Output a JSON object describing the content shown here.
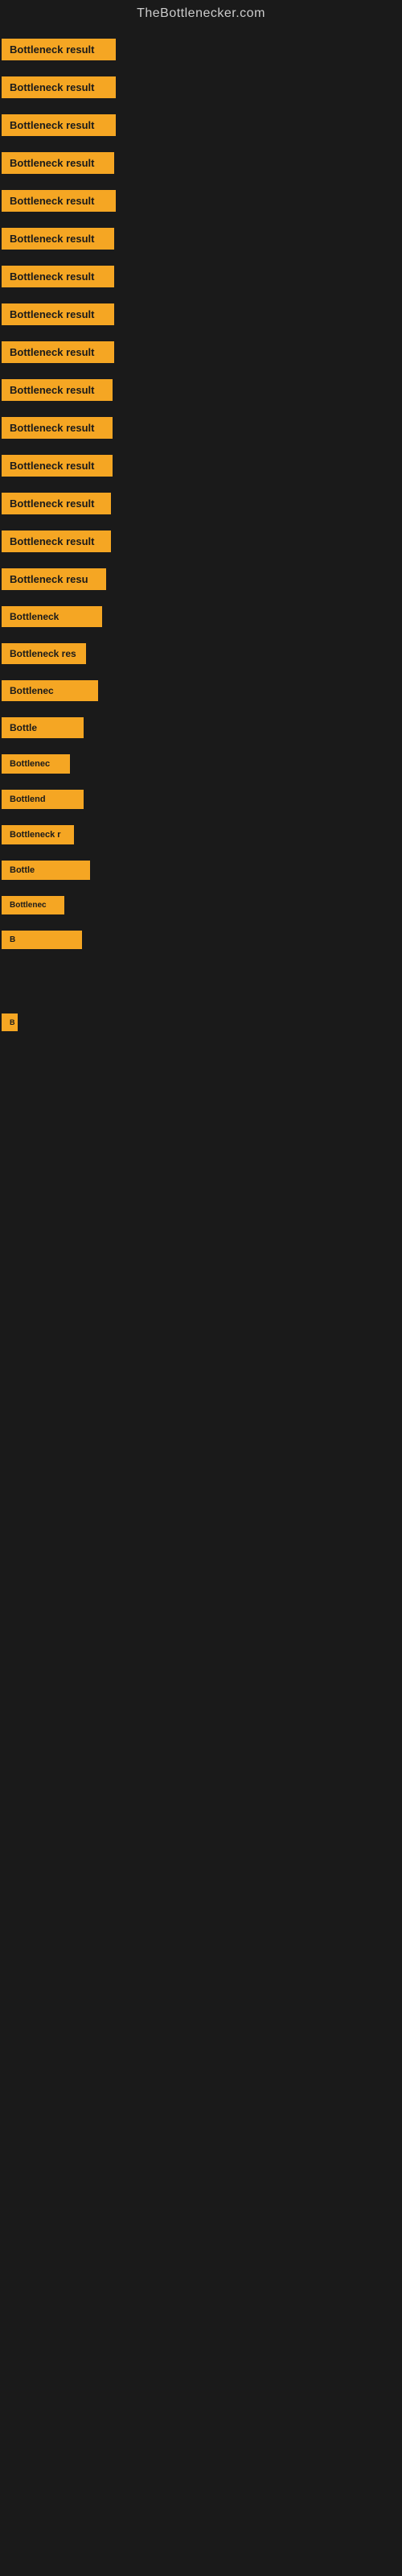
{
  "site": {
    "title": "TheBottlenecker.com"
  },
  "items": [
    {
      "id": 1,
      "label": "Bottleneck result"
    },
    {
      "id": 2,
      "label": "Bottleneck result"
    },
    {
      "id": 3,
      "label": "Bottleneck result"
    },
    {
      "id": 4,
      "label": "Bottleneck result"
    },
    {
      "id": 5,
      "label": "Bottleneck result"
    },
    {
      "id": 6,
      "label": "Bottleneck result"
    },
    {
      "id": 7,
      "label": "Bottleneck result"
    },
    {
      "id": 8,
      "label": "Bottleneck result"
    },
    {
      "id": 9,
      "label": "Bottleneck result"
    },
    {
      "id": 10,
      "label": "Bottleneck result"
    },
    {
      "id": 11,
      "label": "Bottleneck result"
    },
    {
      "id": 12,
      "label": "Bottleneck result"
    },
    {
      "id": 13,
      "label": "Bottleneck result"
    },
    {
      "id": 14,
      "label": "Bottleneck result"
    },
    {
      "id": 15,
      "label": "Bottleneck resu"
    },
    {
      "id": 16,
      "label": "Bottleneck"
    },
    {
      "id": 17,
      "label": "Bottleneck res"
    },
    {
      "id": 18,
      "label": "Bottlenec"
    },
    {
      "id": 19,
      "label": "Bottle"
    },
    {
      "id": 20,
      "label": "Bottlenec"
    },
    {
      "id": 21,
      "label": "Bottlend"
    },
    {
      "id": 22,
      "label": "Bottleneck r"
    },
    {
      "id": 23,
      "label": "Bottle"
    },
    {
      "id": 24,
      "label": "Bottlenec"
    },
    {
      "id": 25,
      "label": "B"
    },
    {
      "id": 26,
      "label": ""
    },
    {
      "id": 27,
      "label": ""
    },
    {
      "id": 28,
      "label": ""
    },
    {
      "id": 29,
      "label": "B"
    },
    {
      "id": 30,
      "label": ""
    },
    {
      "id": 31,
      "label": ""
    },
    {
      "id": 32,
      "label": ""
    },
    {
      "id": 33,
      "label": ""
    },
    {
      "id": 34,
      "label": ""
    },
    {
      "id": 35,
      "label": ""
    }
  ],
  "colors": {
    "badge_bg": "#f5a623",
    "background": "#1a1a1a",
    "title_color": "#cccccc"
  }
}
